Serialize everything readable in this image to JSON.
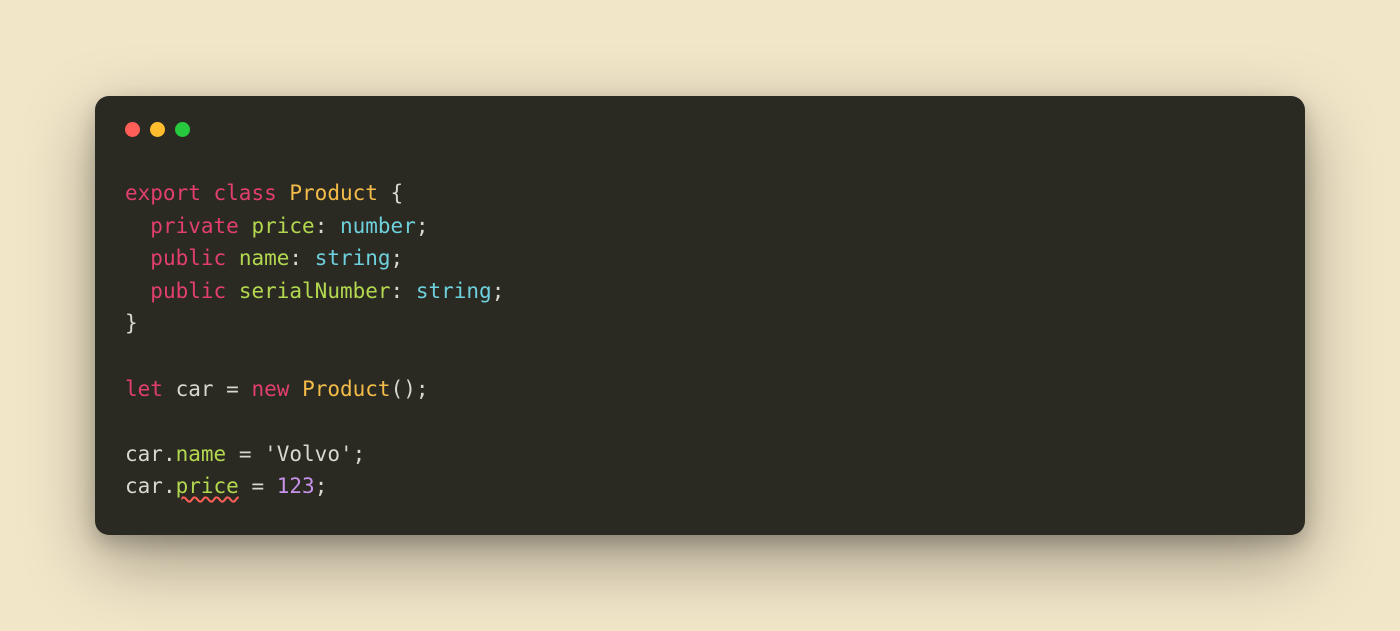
{
  "code": {
    "line1": {
      "export_kw": "export",
      "class_kw": "class",
      "class_name": "Product",
      "brace_open": " {"
    },
    "line2": {
      "indent": "  ",
      "modifier": "private",
      "member": "price",
      "colon": ": ",
      "type": "number",
      "semi": ";"
    },
    "line3": {
      "indent": "  ",
      "modifier": "public",
      "member": "name",
      "colon": ": ",
      "type": "string",
      "semi": ";"
    },
    "line4": {
      "indent": "  ",
      "modifier": "public",
      "member": "serialNumber",
      "colon": ": ",
      "type": "string",
      "semi": ";"
    },
    "line5": {
      "brace_close": "}"
    },
    "line7": {
      "let_kw": "let",
      "var": "car",
      "eq": " = ",
      "new_kw": "new",
      "class_name": "Product",
      "call": "();"
    },
    "line9": {
      "obj": "car",
      "dot": ".",
      "member": "name",
      "eq": " = ",
      "string": "'Volvo'",
      "semi": ";"
    },
    "line10": {
      "obj": "car",
      "dot": ".",
      "member_error": "price",
      "eq": " = ",
      "number": "123",
      "semi": ";"
    }
  },
  "colors": {
    "background_page": "#f2e6c9",
    "background_window": "#2a2a22",
    "keyword": "#e23f6c",
    "class_name": "#f5bc4a",
    "member": "#b3d84f",
    "type": "#6ed0dd",
    "text": "#d8d8d0",
    "number": "#c792ea",
    "error_underline": "#ff5f56",
    "traffic_red": "#ff5f56",
    "traffic_yellow": "#ffbd2e",
    "traffic_green": "#27c93f"
  }
}
